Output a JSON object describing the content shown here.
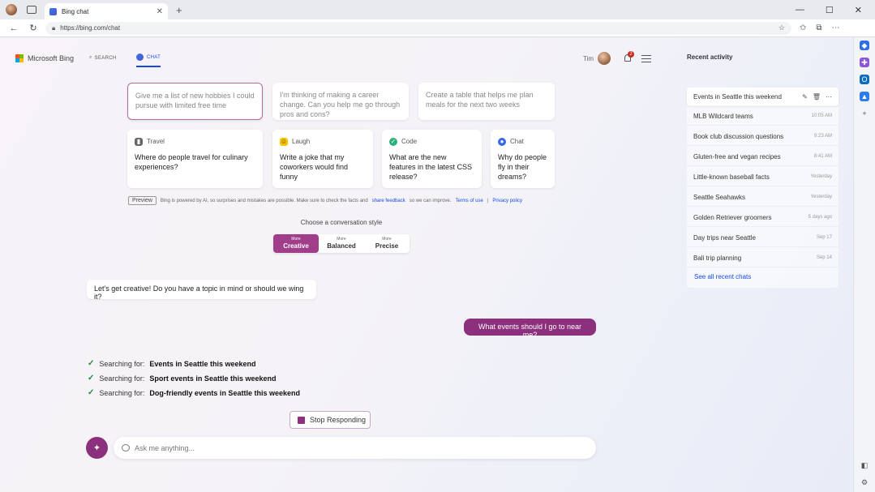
{
  "browser": {
    "tab_title": "Bing chat",
    "tab_close": "✕",
    "new_tab": "+",
    "url": "https://bing.com/chat",
    "win_min": "—",
    "win_max": "☐",
    "win_close": "✕"
  },
  "header": {
    "logo_text": "Microsoft Bing",
    "nav_search": "SEARCH",
    "nav_chat": "CHAT",
    "user_name": "Tim",
    "notification_count": "2"
  },
  "prompts_top": [
    {
      "text": "Give me a list of new hobbies I could pursue with limited free time"
    },
    {
      "text": "I'm thinking of making a career change. Can you help me go through pros and cons?"
    },
    {
      "text": "Create a table that helps me plan meals for the next two weeks"
    }
  ],
  "prompts": [
    {
      "category": "Travel",
      "text": "Where do people travel for culinary experiences?"
    },
    {
      "category": "Laugh",
      "text": "Write a joke that my coworkers would find funny"
    },
    {
      "category": "Code",
      "text": "What are the new features in the latest CSS release?"
    },
    {
      "category": "Chat",
      "text": "Why do people fly in their dreams?"
    }
  ],
  "preview": {
    "badge": "Preview",
    "text": "Bing is powered by AI, so surprises and mistakes are possible. Make sure to check the facts and",
    "share_feedback": "share feedback",
    "text2": "so we can improve.",
    "terms": "Terms of use",
    "sep": "|",
    "privacy": "Privacy policy"
  },
  "style_picker": {
    "label": "Choose a conversation style",
    "options": [
      {
        "more": "More",
        "name": "Creative"
      },
      {
        "more": "More",
        "name": "Balanced"
      },
      {
        "more": "More",
        "name": "Precise"
      }
    ]
  },
  "conversation": {
    "bot_greeting": "Let's get creative! Do you have a topic in mind or should we wing it?",
    "user_message": "What events should I go to near me?",
    "searching_prefix": "Searching for:",
    "searches": [
      "Events in Seattle this weekend",
      "Sport events in Seattle this weekend",
      "Dog-friendly events in Seattle this weekend"
    ],
    "stop_label": "Stop Responding"
  },
  "input": {
    "placeholder": "Ask me anything..."
  },
  "recent": {
    "title": "Recent activity",
    "items": [
      {
        "title": "Events in Seattle this weekend",
        "date": ""
      },
      {
        "title": "MLB Wildcard teams",
        "date": "10:05 AM"
      },
      {
        "title": "Book club discussion questions",
        "date": "9:23 AM"
      },
      {
        "title": "Gluten-free and vegan recipes",
        "date": "8:41 AM"
      },
      {
        "title": "Little-known baseball facts",
        "date": "Yesterday"
      },
      {
        "title": "Seattle Seahawks",
        "date": "Yesterday"
      },
      {
        "title": "Golden Retriever groomers",
        "date": "5 days ago"
      },
      {
        "title": "Day trips near Seattle",
        "date": "Sep 17"
      },
      {
        "title": "Bali trip planning",
        "date": "Sep 14"
      }
    ],
    "see_all": "See all recent chats"
  }
}
